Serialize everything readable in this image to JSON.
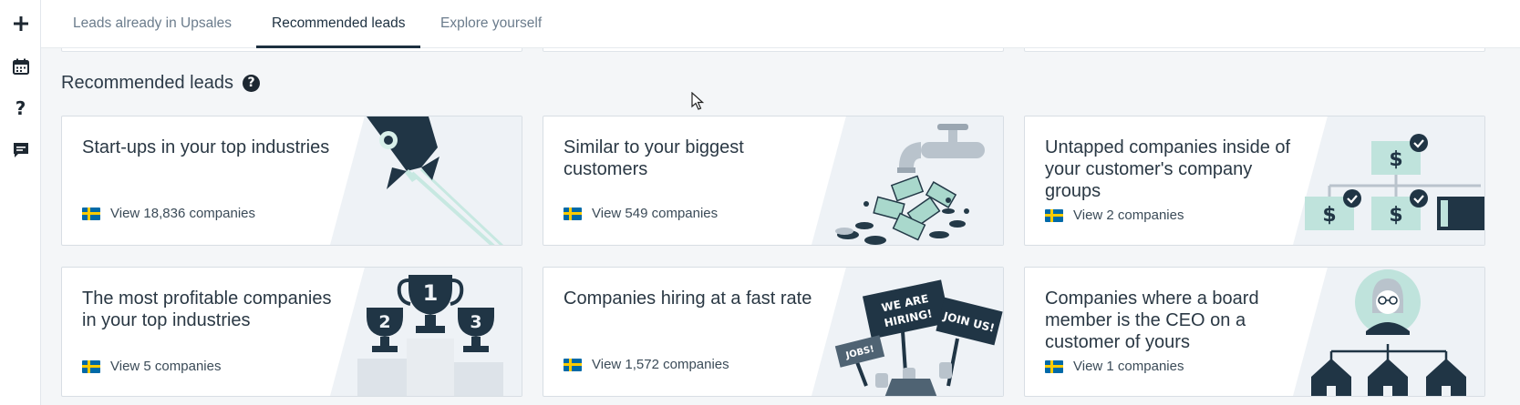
{
  "sidebar": {
    "items": [
      {
        "icon": "plus-icon"
      },
      {
        "icon": "calendar-icon"
      },
      {
        "icon": "question-icon"
      },
      {
        "icon": "chat-icon"
      }
    ]
  },
  "tabs": [
    {
      "label": "Leads already in Upsales",
      "active": false
    },
    {
      "label": "Recommended leads",
      "active": true
    },
    {
      "label": "Explore yourself",
      "active": false
    }
  ],
  "section": {
    "title": "Recommended leads",
    "help_icon": "?"
  },
  "cards": [
    {
      "title": "Start-ups in your top industries",
      "link": "View 18,836 companies",
      "illustration": "rocket"
    },
    {
      "title": "Similar to your biggest customers",
      "link": "View 549 companies",
      "illustration": "money-faucet"
    },
    {
      "title": "Untapped companies inside of your customer's company groups",
      "link": "View 2 companies",
      "illustration": "company-group-tree"
    },
    {
      "title": "The most profitable companies in your top industries",
      "link": "View 5 companies",
      "illustration": "trophies",
      "trophy_labels": [
        "1",
        "2",
        "3"
      ]
    },
    {
      "title": "Companies hiring at a fast rate",
      "link": "View 1,572 companies",
      "illustration": "protest-signs",
      "sign_texts": [
        "WE ARE",
        "HIRING!",
        "JOIN US!",
        "JOBS!"
      ]
    },
    {
      "title": "Companies where a board member is the CEO on a customer of yours",
      "link": "View 1 companies",
      "illustration": "person-houses"
    }
  ],
  "colors": {
    "dark": "#1d3040",
    "teal_light": "#bfe3dc",
    "illustration_bg": "#eef2f6",
    "flag_blue": "#006aa7",
    "flag_yellow": "#fecc00"
  }
}
